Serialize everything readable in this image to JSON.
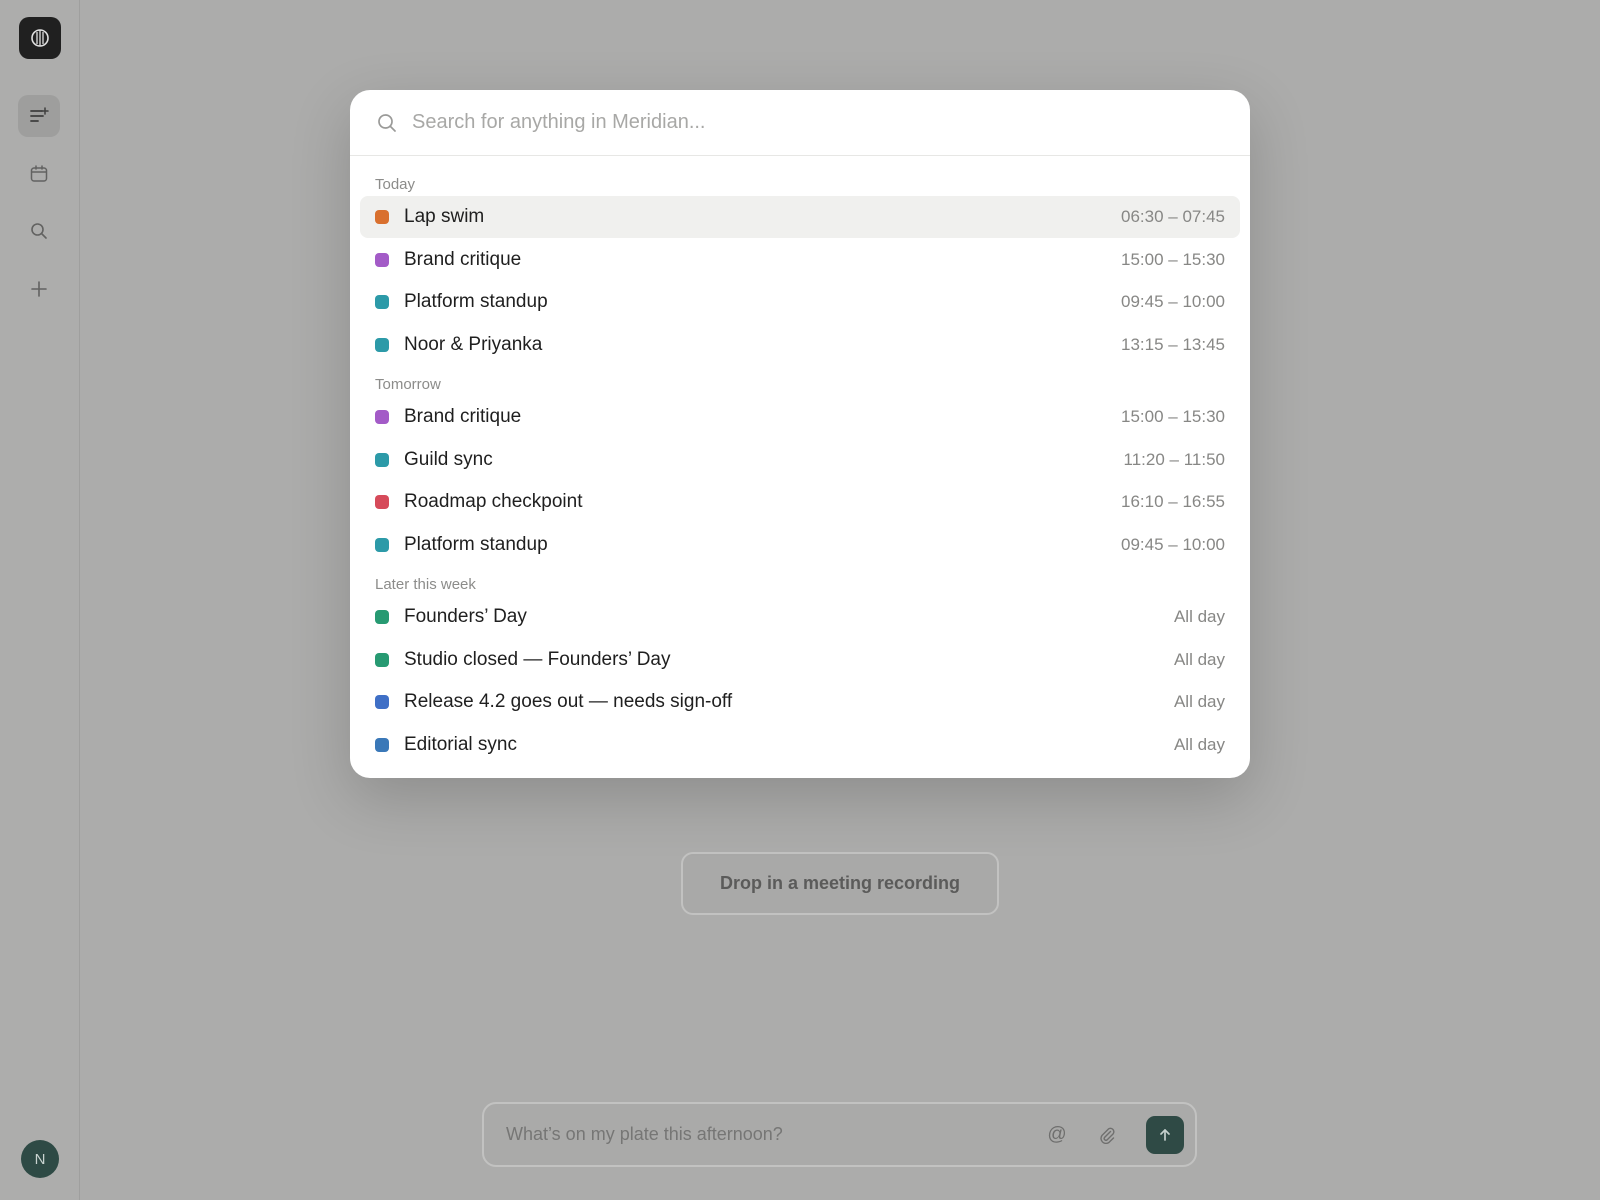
{
  "sidebar": {
    "nav": [
      "menu-icon",
      "calendar-icon",
      "search-icon",
      "plus-icon"
    ],
    "avatar_initial": "N"
  },
  "background": {
    "drop_label": "Drop in a meeting recording",
    "composer_placeholder": "What’s on my plate this afternoon?"
  },
  "palette": {
    "search_placeholder": "Search for anything in Meridian...",
    "sections": [
      {
        "label": "Today",
        "items": [
          {
            "title": "Lap swim",
            "time": "06:30 – 07:45",
            "color": "#d9702e",
            "selected": true
          },
          {
            "title": "Brand critique",
            "time": "15:00 – 15:30",
            "color": "#a35bc7"
          },
          {
            "title": "Platform standup",
            "time": "09:45 – 10:00",
            "color": "#2c9aa8"
          },
          {
            "title": "Noor & Priyanka",
            "time": "13:15 – 13:45",
            "color": "#2c9aa8"
          }
        ]
      },
      {
        "label": "Tomorrow",
        "items": [
          {
            "title": "Brand critique",
            "time": "15:00 – 15:30",
            "color": "#a35bc7"
          },
          {
            "title": "Guild sync",
            "time": "11:20 – 11:50",
            "color": "#2c9aa8"
          },
          {
            "title": "Roadmap checkpoint",
            "time": "16:10 – 16:55",
            "color": "#d64a5a"
          },
          {
            "title": "Platform standup",
            "time": "09:45 – 10:00",
            "color": "#2c9aa8"
          }
        ]
      },
      {
        "label": "Later this week",
        "items": [
          {
            "title": "Founders’ Day",
            "time": "All day",
            "color": "#279a72"
          },
          {
            "title": "Studio closed — Founders’ Day",
            "time": "All day",
            "color": "#279a72"
          },
          {
            "title": "Release 4.2 goes out — needs sign-off",
            "time": "All day",
            "color": "#3f6fc6"
          },
          {
            "title": "Editorial sync",
            "time": "All day",
            "color": "#3a78b8"
          }
        ]
      }
    ]
  }
}
